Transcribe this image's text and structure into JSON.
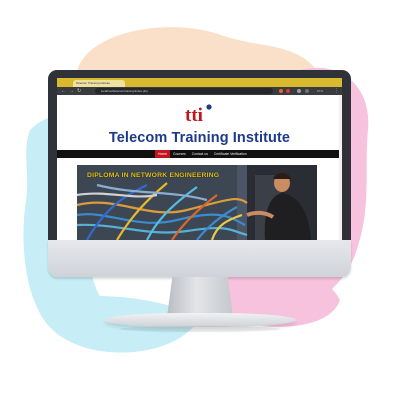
{
  "colors": {
    "blob_pink": "#f7c2dd",
    "blob_peach": "#fbe0c9",
    "blob_cyan": "#c7eef6",
    "brand_blue": "#1e3a8a",
    "brand_red": "#c0151c",
    "hero_text": "#e6c21b"
  },
  "browser": {
    "tab_label": "Telecom Training Institute",
    "url": "localhost/telecomtraining/index.php",
    "zoom": "67%",
    "icons": [
      "back-arrow-icon",
      "forward-arrow-icon",
      "reload-icon",
      "extension-icon",
      "profile-icon",
      "menu-icon"
    ]
  },
  "site": {
    "logo_text": "tti",
    "title": "Telecom Training Institute",
    "nav": [
      {
        "label": "Home",
        "active": true
      },
      {
        "label": "Courses",
        "active": false
      },
      {
        "label": "Contact us",
        "active": false
      },
      {
        "label": "Certificate Verification",
        "active": false
      }
    ],
    "hero_title": "DIPLOMA IN NETWORK ENGINEERING"
  }
}
